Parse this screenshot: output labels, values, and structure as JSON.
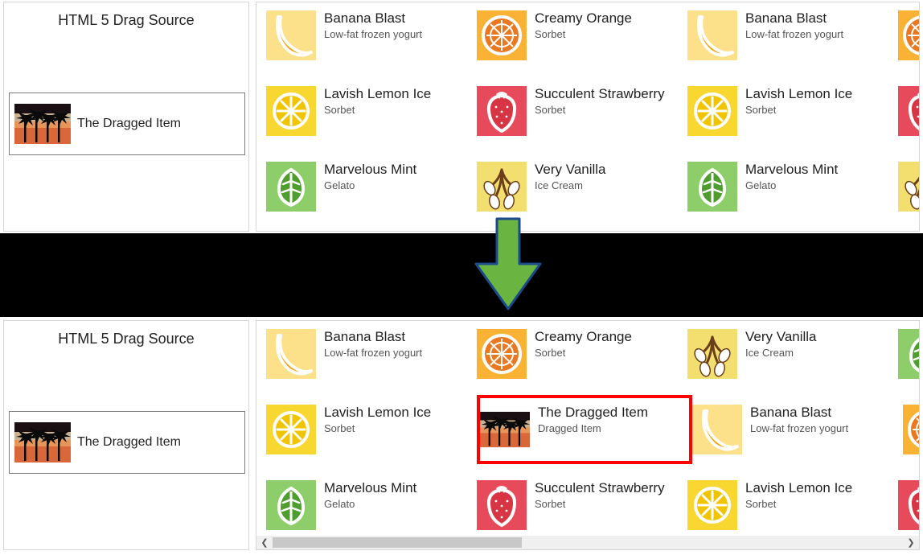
{
  "source_panel": {
    "title": "HTML 5 Drag Source"
  },
  "drag_item": {
    "label": "The Dragged Item",
    "sub": "Dragged Item"
  },
  "icons": {
    "banana": "banana-icon",
    "orange": "orange-icon",
    "vanilla": "vanilla-icon",
    "lemon": "lemon-icon",
    "strawberry": "strawberry-icon",
    "mint": "mint-icon",
    "palm": "palm-icon"
  },
  "colors": {
    "band": "#000000",
    "arrow_fill": "#6ab542",
    "arrow_stroke": "#1b4a8a",
    "highlight": "#ff0000",
    "banana_bg": "#fde08a",
    "banana_fg": "#f5a100",
    "orange_bg": "#f9b233",
    "orange_fg": "#e97820",
    "lemon_bg": "#f7d730",
    "lemon_fg": "#ffffff",
    "strawberry_bg": "#e74b5b",
    "strawberry_fg": "#ffffff",
    "mint_bg": "#8dce6a",
    "mint_fg": "#4f9d2f",
    "vanilla_bg": "#f3de70"
  },
  "before": {
    "rows": [
      [
        {
          "icon": "banana",
          "title": "Banana Blast",
          "sub": "Low-fat frozen yogurt"
        },
        {
          "icon": "orange",
          "title": "Creamy Orange",
          "sub": "Sorbet"
        },
        {
          "icon": "banana",
          "title": "Banana Blast",
          "sub": "Low-fat frozen yogurt"
        },
        {
          "icon": "orange",
          "title": "",
          "sub": ""
        }
      ],
      [
        {
          "icon": "lemon",
          "title": "Lavish Lemon Ice",
          "sub": "Sorbet"
        },
        {
          "icon": "strawberry",
          "title": "Succulent Strawberry",
          "sub": "Sorbet"
        },
        {
          "icon": "lemon",
          "title": "Lavish Lemon Ice",
          "sub": "Sorbet"
        },
        {
          "icon": "strawberry",
          "title": "",
          "sub": ""
        }
      ],
      [
        {
          "icon": "mint",
          "title": "Marvelous Mint",
          "sub": "Gelato"
        },
        {
          "icon": "vanilla",
          "title": "Very Vanilla",
          "sub": "Ice Cream"
        },
        {
          "icon": "mint",
          "title": "Marvelous Mint",
          "sub": "Gelato"
        },
        {
          "icon": "vanilla",
          "title": "",
          "sub": ""
        }
      ]
    ]
  },
  "after": {
    "rows": [
      [
        {
          "icon": "banana",
          "title": "Banana Blast",
          "sub": "Low-fat frozen yogurt"
        },
        {
          "icon": "orange",
          "title": "Creamy Orange",
          "sub": "Sorbet"
        },
        {
          "icon": "vanilla",
          "title": "Very Vanilla",
          "sub": "Ice Cream"
        },
        {
          "icon": "mint",
          "title": "",
          "sub": ""
        }
      ],
      [
        {
          "icon": "lemon",
          "title": "Lavish Lemon Ice",
          "sub": "Sorbet"
        },
        {
          "icon": "palm",
          "title": "The Dragged Item",
          "sub": "Dragged Item",
          "highlight": true
        },
        {
          "icon": "banana",
          "title": "Banana Blast",
          "sub": "Low-fat frozen yogurt"
        },
        {
          "icon": "orange",
          "title": "",
          "sub": ""
        }
      ],
      [
        {
          "icon": "mint",
          "title": "Marvelous Mint",
          "sub": "Gelato"
        },
        {
          "icon": "strawberry",
          "title": "Succulent Strawberry",
          "sub": "Sorbet"
        },
        {
          "icon": "lemon",
          "title": "Lavish Lemon Ice",
          "sub": "Sorbet"
        },
        {
          "icon": "strawberry",
          "title": "",
          "sub": ""
        }
      ]
    ]
  }
}
